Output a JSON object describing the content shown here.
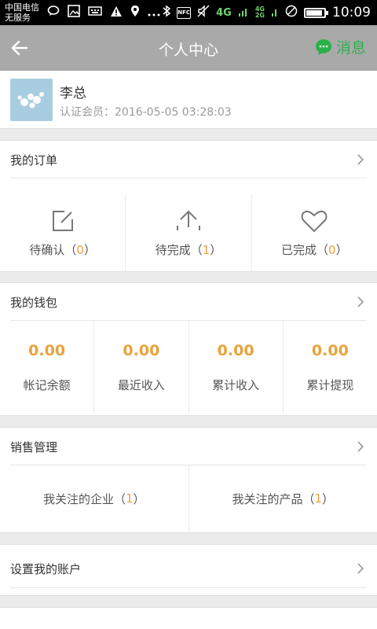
{
  "status_bar": {
    "carrier_line1": "中国电信",
    "carrier_line2": "无服务",
    "network_4g": "4G",
    "network_4g_small": "4G",
    "network_2g_small": "2G",
    "nfc": "NFC",
    "time": "10:09",
    "battery_level": 0.9
  },
  "header": {
    "title": "个人中心",
    "messages_label": "消息",
    "accent_color": "#2bb14a"
  },
  "profile": {
    "name": "李总",
    "member_label": "认证会员：",
    "member_since": "2016-05-05 03:28:03"
  },
  "orders": {
    "title": "我的订单",
    "items": [
      {
        "label": "待确认（",
        "count": "0",
        "suffix": "）",
        "icon": "edit-icon"
      },
      {
        "label": "待完成（",
        "count": "1",
        "suffix": "）",
        "icon": "upload-icon"
      },
      {
        "label": "已完成（",
        "count": "0",
        "suffix": "）",
        "icon": "heart-icon"
      }
    ]
  },
  "wallet": {
    "title": "我的钱包",
    "items": [
      {
        "amount": "0.00",
        "label": "帐记余额"
      },
      {
        "amount": "0.00",
        "label": "最近收入"
      },
      {
        "amount": "0.00",
        "label": "累计收入"
      },
      {
        "amount": "0.00",
        "label": "累计提现"
      }
    ]
  },
  "sales": {
    "title": "销售管理",
    "items": [
      {
        "label": "我关注的企业（",
        "count": "1",
        "suffix": "）"
      },
      {
        "label": "我关注的产品（",
        "count": "1",
        "suffix": "）"
      }
    ]
  },
  "account": {
    "title": "设置我的账户"
  },
  "colors": {
    "highlight": "#e8a33a",
    "titlebar": "#a9a9a9"
  }
}
